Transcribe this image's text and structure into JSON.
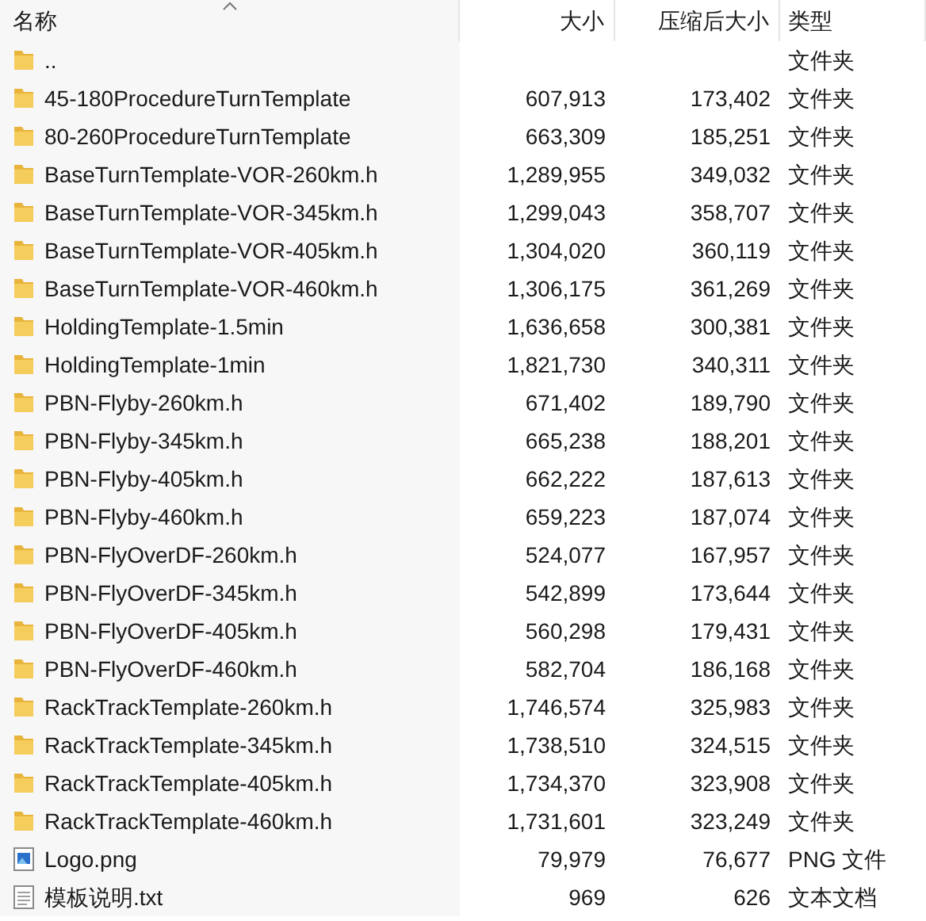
{
  "columns": [
    {
      "label": "名称",
      "sorted": true
    },
    {
      "label": "大小",
      "sorted": false
    },
    {
      "label": "压缩后大小",
      "sorted": false
    },
    {
      "label": "类型",
      "sorted": false
    }
  ],
  "rows": [
    {
      "kind": "folder",
      "name": "..",
      "type": "文件夹"
    },
    {
      "kind": "folder",
      "name": "45-180ProcedureTurnTemplate",
      "size": "607,913",
      "packed": "173,402",
      "type": "文件夹"
    },
    {
      "kind": "folder",
      "name": "80-260ProcedureTurnTemplate",
      "size": "663,309",
      "packed": "185,251",
      "type": "文件夹"
    },
    {
      "kind": "folder",
      "name": "BaseTurnTemplate-VOR-260km.h",
      "size": "1,289,955",
      "packed": "349,032",
      "type": "文件夹"
    },
    {
      "kind": "folder",
      "name": "BaseTurnTemplate-VOR-345km.h",
      "size": "1,299,043",
      "packed": "358,707",
      "type": "文件夹"
    },
    {
      "kind": "folder",
      "name": "BaseTurnTemplate-VOR-405km.h",
      "size": "1,304,020",
      "packed": "360,119",
      "type": "文件夹"
    },
    {
      "kind": "folder",
      "name": "BaseTurnTemplate-VOR-460km.h",
      "size": "1,306,175",
      "packed": "361,269",
      "type": "文件夹"
    },
    {
      "kind": "folder",
      "name": "HoldingTemplate-1.5min",
      "size": "1,636,658",
      "packed": "300,381",
      "type": "文件夹"
    },
    {
      "kind": "folder",
      "name": "HoldingTemplate-1min",
      "size": "1,821,730",
      "packed": "340,311",
      "type": "文件夹"
    },
    {
      "kind": "folder",
      "name": "PBN-Flyby-260km.h",
      "size": "671,402",
      "packed": "189,790",
      "type": "文件夹"
    },
    {
      "kind": "folder",
      "name": "PBN-Flyby-345km.h",
      "size": "665,238",
      "packed": "188,201",
      "type": "文件夹"
    },
    {
      "kind": "folder",
      "name": "PBN-Flyby-405km.h",
      "size": "662,222",
      "packed": "187,613",
      "type": "文件夹"
    },
    {
      "kind": "folder",
      "name": "PBN-Flyby-460km.h",
      "size": "659,223",
      "packed": "187,074",
      "type": "文件夹"
    },
    {
      "kind": "folder",
      "name": "PBN-FlyOverDF-260km.h",
      "size": "524,077",
      "packed": "167,957",
      "type": "文件夹"
    },
    {
      "kind": "folder",
      "name": "PBN-FlyOverDF-345km.h",
      "size": "542,899",
      "packed": "173,644",
      "type": "文件夹"
    },
    {
      "kind": "folder",
      "name": "PBN-FlyOverDF-405km.h",
      "size": "560,298",
      "packed": "179,431",
      "type": "文件夹"
    },
    {
      "kind": "folder",
      "name": "PBN-FlyOverDF-460km.h",
      "size": "582,704",
      "packed": "186,168",
      "type": "文件夹"
    },
    {
      "kind": "folder",
      "name": "RackTrackTemplate-260km.h",
      "size": "1,746,574",
      "packed": "325,983",
      "type": "文件夹"
    },
    {
      "kind": "folder",
      "name": "RackTrackTemplate-345km.h",
      "size": "1,738,510",
      "packed": "324,515",
      "type": "文件夹"
    },
    {
      "kind": "folder",
      "name": "RackTrackTemplate-405km.h",
      "size": "1,734,370",
      "packed": "323,908",
      "type": "文件夹"
    },
    {
      "kind": "folder",
      "name": "RackTrackTemplate-460km.h",
      "size": "1,731,601",
      "packed": "323,249",
      "type": "文件夹"
    },
    {
      "kind": "image",
      "name": "Logo.png",
      "size": "79,979",
      "packed": "76,677",
      "type": "PNG 文件"
    },
    {
      "kind": "text",
      "name": "模板说明.txt",
      "size": "969",
      "packed": "626",
      "type": "文本文档"
    }
  ]
}
